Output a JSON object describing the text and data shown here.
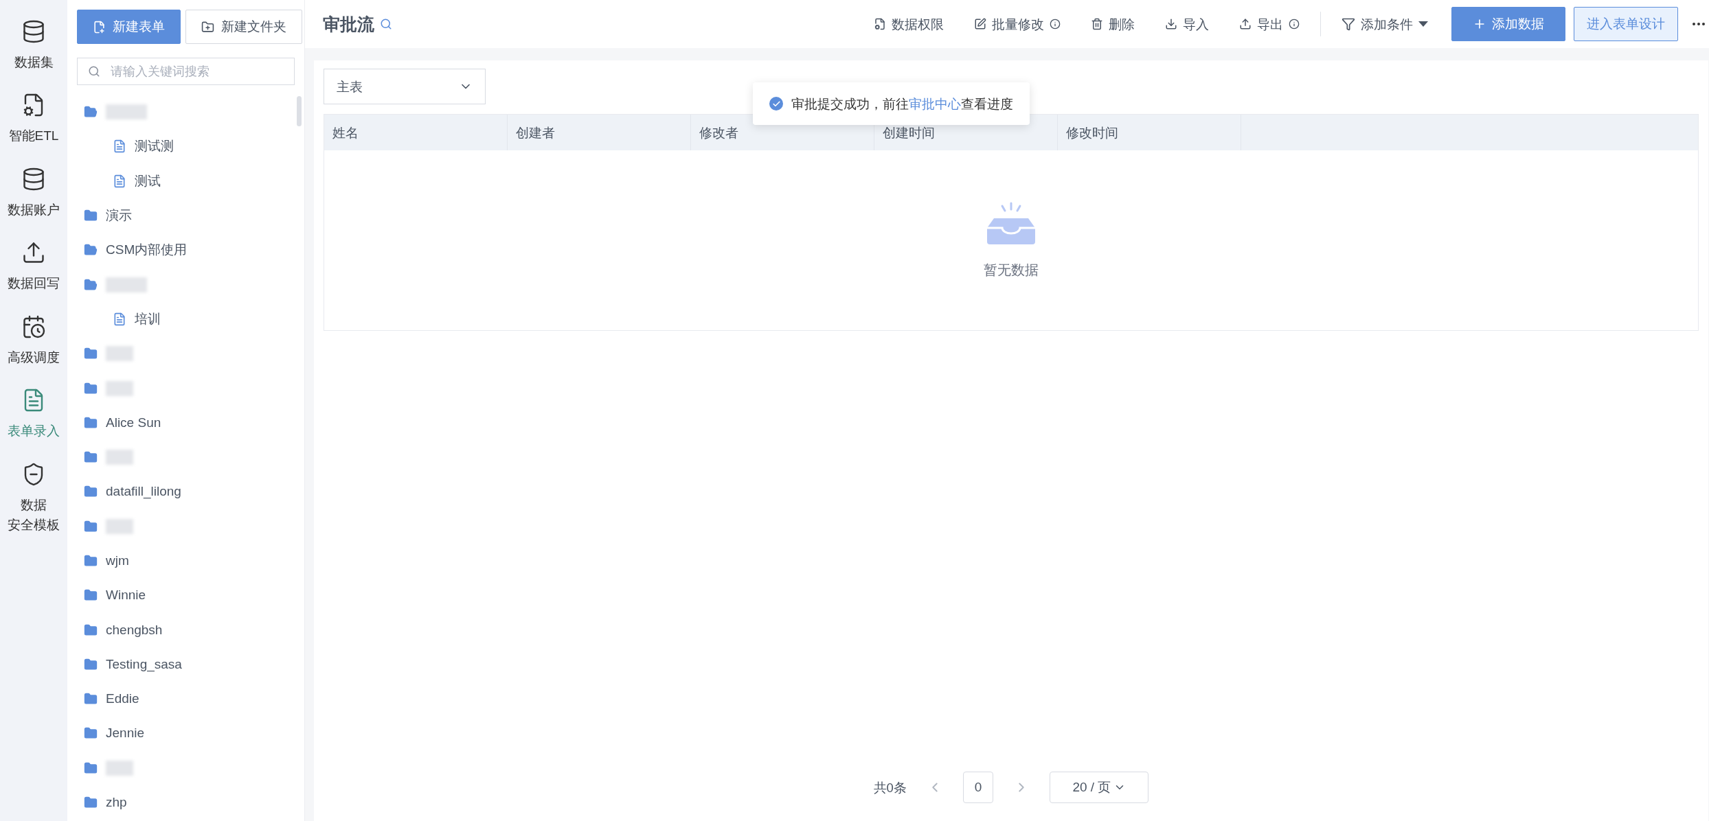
{
  "nav": [
    {
      "lines": [
        "数据集"
      ],
      "selected": false
    },
    {
      "lines": [
        "智能ETL"
      ],
      "selected": false
    },
    {
      "lines": [
        "数据账户"
      ],
      "selected": false
    },
    {
      "lines": [
        "数据回写"
      ],
      "selected": false
    },
    {
      "lines": [
        "高级调度"
      ],
      "selected": false
    },
    {
      "lines": [
        "表单录入"
      ],
      "selected": true
    },
    {
      "lines": [
        "数据",
        "安全模板"
      ],
      "selected": false
    }
  ],
  "sidebar": {
    "buttons": [
      {
        "label": "新建表单",
        "kind": "primary"
      },
      {
        "label": "新建文件夹",
        "kind": "secondary"
      }
    ],
    "search": {
      "placeholder": "请输入关键词搜索"
    },
    "tree": [
      {
        "kind": "redacted",
        "expanded": true,
        "children": [
          {
            "kind": "form",
            "label": "测试测"
          },
          {
            "kind": "form",
            "label": "测试"
          }
        ]
      },
      {
        "kind": "folder",
        "label": "演示",
        "expanded": false
      },
      {
        "kind": "folder",
        "label": "CSM内部使用",
        "expanded": true
      },
      {
        "kind": "redacted",
        "expanded": true,
        "children": [
          {
            "kind": "form",
            "label": "培训"
          }
        ]
      },
      {
        "kind": "redacted",
        "expanded": false
      },
      {
        "kind": "redacted",
        "expanded": false
      },
      {
        "kind": "folder",
        "label": "Alice Sun",
        "expanded": false
      },
      {
        "kind": "redacted",
        "expanded": false
      },
      {
        "kind": "folder",
        "label": "datafill_lilong",
        "expanded": false
      },
      {
        "kind": "redacted",
        "expanded": false
      },
      {
        "kind": "folder",
        "label": "wjm",
        "expanded": false
      },
      {
        "kind": "folder",
        "label": "Winnie",
        "expanded": false
      },
      {
        "kind": "folder",
        "label": "chengbsh",
        "expanded": false
      },
      {
        "kind": "folder",
        "label": "Testing_sasa",
        "expanded": false
      },
      {
        "kind": "folder",
        "label": "Eddie",
        "expanded": false
      },
      {
        "kind": "folder",
        "label": "Jennie",
        "expanded": false
      },
      {
        "kind": "redacted",
        "expanded": false
      },
      {
        "kind": "folder",
        "label": "zhp",
        "expanded": false
      }
    ]
  },
  "header": {
    "title": "审批流",
    "actions": [
      {
        "label": "数据权限",
        "info": false
      },
      {
        "label": "批量修改",
        "info": true
      },
      {
        "label": "删除",
        "info": false
      },
      {
        "label": "导入",
        "info": false
      },
      {
        "label": "导出",
        "info": true
      }
    ],
    "filter": {
      "label": "添加条件"
    },
    "buttons": [
      {
        "label": "添加数据",
        "kind": "primary"
      },
      {
        "label": "进入表单设计",
        "kind": "outline"
      }
    ]
  },
  "table_select": {
    "value": "主表"
  },
  "toast": {
    "before": "审批提交成功，前往",
    "link": "审批中心",
    "after": "查看进度"
  },
  "table": {
    "columns": [
      "姓名",
      "创建者",
      "修改者",
      "创建时间",
      "修改时间"
    ],
    "empty_text": "暂无数据"
  },
  "pagination": {
    "total": "共0条",
    "page": "0",
    "page_size": "20 / 页"
  }
}
